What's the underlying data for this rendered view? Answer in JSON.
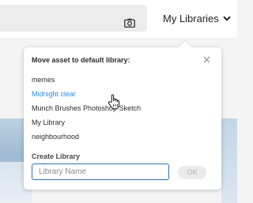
{
  "header": {
    "camera_icon": "camera-icon",
    "libraries_label": "My Libraries",
    "libraries_chevron": "chevron-down-icon"
  },
  "popover": {
    "title": "Move asset to default library:",
    "close_icon": "close-icon",
    "libraries": [
      {
        "label": "memes"
      },
      {
        "label": "Midnight clear",
        "hovered": true
      },
      {
        "label": "Munch Brushes Photoshop Sketch"
      },
      {
        "label": "My Library"
      },
      {
        "label": "neighbourhood"
      }
    ],
    "create_label": "Create Library",
    "input_placeholder": "Library Name",
    "input_value": "",
    "ok_label": "OK"
  },
  "colors": {
    "hover_link": "#2d8ceb",
    "input_border": "#2d6fb5",
    "ok_disabled_bg": "#ebebeb",
    "ok_disabled_text": "#b2b2b2"
  }
}
